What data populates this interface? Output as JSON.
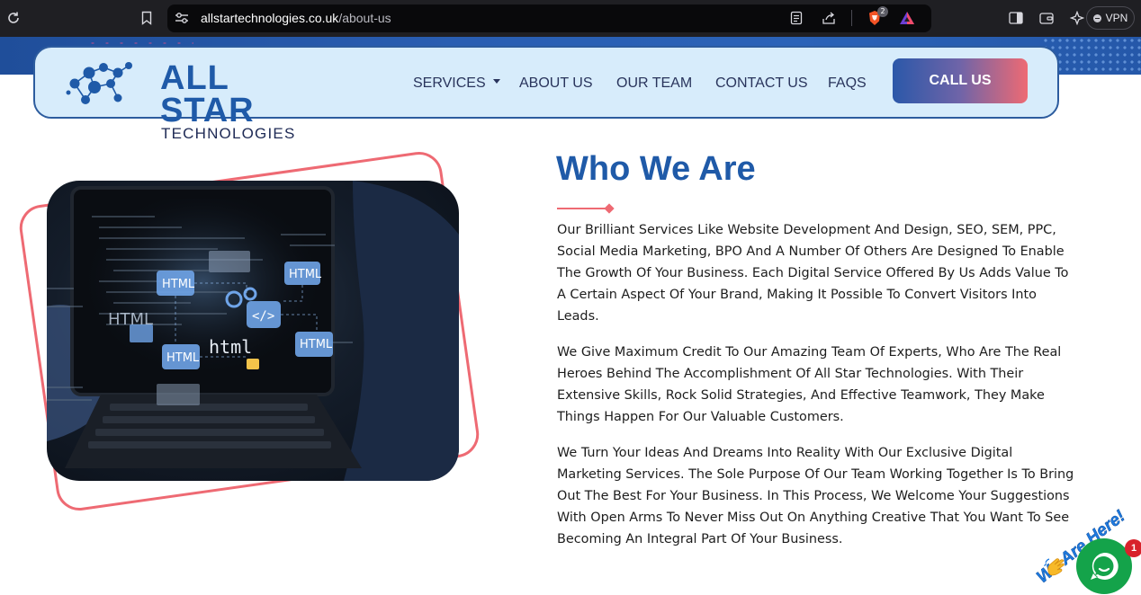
{
  "browser": {
    "url_domain": "allstartechnologies.co.uk",
    "url_path": "/about-us",
    "shields_count": "2",
    "vpn_label": "VPN"
  },
  "header": {
    "logo_main": "ALL STAR",
    "logo_sub": "TECHNOLOGIES",
    "nav": [
      {
        "label": "SERVICES",
        "has_dropdown": true
      },
      {
        "label": "ABOUT US"
      },
      {
        "label": "OUR TEAM"
      },
      {
        "label": "CONTACT US"
      },
      {
        "label": "FAQS"
      }
    ],
    "cta_label": "CALL US"
  },
  "hero_image": {
    "labels": [
      "HTML",
      "HTML",
      "HTML",
      "HTML",
      "HTML",
      "html",
      "</>"
    ]
  },
  "content": {
    "title": "Who We Are",
    "paragraphs": [
      "Our Brilliant Services Like Website Development And Design, SEO, SEM, PPC, Social Media Marketing, BPO And A Number Of Others Are Designed To Enable The Growth Of Your Business. Each Digital Service Offered By Us Adds Value To A Certain Aspect Of Your Brand, Making It Possible To Convert Visitors Into Leads.",
      "We Give Maximum Credit To Our Amazing Team Of Experts, Who Are The Real Heroes Behind The Accomplishment Of All Star Technologies. With Their Extensive Skills, Rock Solid Strategies, And Effective Teamwork, They Make Things Happen For Our Valuable Customers.",
      "We Turn Your Ideas And Dreams Into Reality With Our Exclusive Digital Marketing Services. The Sole Purpose Of Our Team Working Together Is To Bring Out The Best For Your Business. In This Process, We Welcome Your Suggestions With Open Arms To Never Miss Out On Anything Creative That You Want To See Becoming An Integral Part Of Your Business."
    ]
  },
  "chat": {
    "greeting": "We Are Here!",
    "unread_count": "1"
  },
  "colors": {
    "brand_blue": "#1f5aa8",
    "accent_coral": "#ee6a73",
    "chat_green": "#14a34a"
  }
}
